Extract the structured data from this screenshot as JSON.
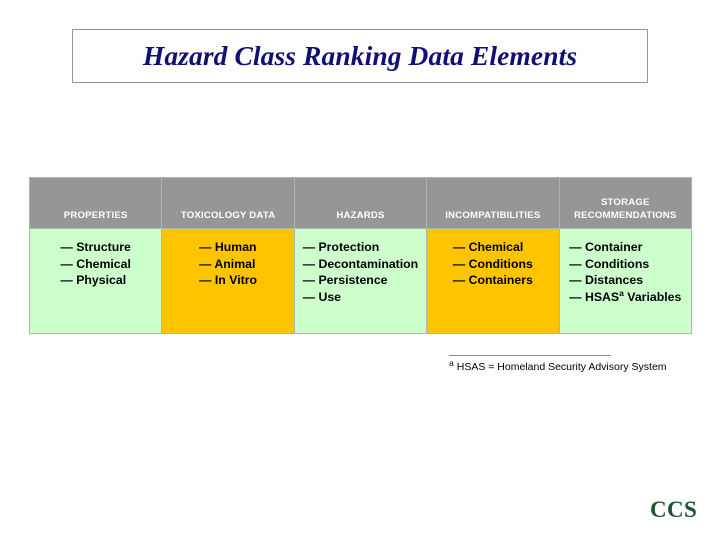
{
  "slide": {
    "title": "Hazard Class Ranking Data Elements",
    "logo": "CCS"
  },
  "table": {
    "columns": [
      {
        "header": "PROPERTIES",
        "fill": "green",
        "items": [
          {
            "text": "— Structure"
          },
          {
            "text": "— Chemical"
          },
          {
            "text": "— Physical"
          }
        ]
      },
      {
        "header": "TOXICOLOGY DATA",
        "fill": "amber",
        "items": [
          {
            "text": "— Human"
          },
          {
            "text": "— Animal"
          },
          {
            "text": "— In Vitro"
          }
        ]
      },
      {
        "header": "HAZARDS",
        "fill": "green",
        "items": [
          {
            "text": "— Protection"
          },
          {
            "text": "— Decontamination"
          },
          {
            "text": "— Persistence"
          },
          {
            "text": "— Use"
          }
        ]
      },
      {
        "header": "INCOMPATIBILITIES",
        "fill": "amber",
        "items": [
          {
            "text": "— Chemical"
          },
          {
            "text": "— Conditions"
          },
          {
            "text": "— Containers"
          }
        ]
      },
      {
        "header": "STORAGE RECOMMENDATIONS",
        "fill": "green",
        "items": [
          {
            "text": "— Container"
          },
          {
            "text": "— Conditions"
          },
          {
            "text": "— Distances"
          },
          {
            "text": "— HSAS",
            "footnote_ref": "a",
            "suffix": " Variables"
          }
        ]
      }
    ]
  },
  "footnote": {
    "marker": "a",
    "text": "HSAS = Homeland Security Advisory System"
  },
  "colors": {
    "header_fill": "#969696",
    "green_fill": "#ccffcc",
    "amber_fill": "#ffc400",
    "title_color": "#101074",
    "logo_color": "#1b5631"
  }
}
